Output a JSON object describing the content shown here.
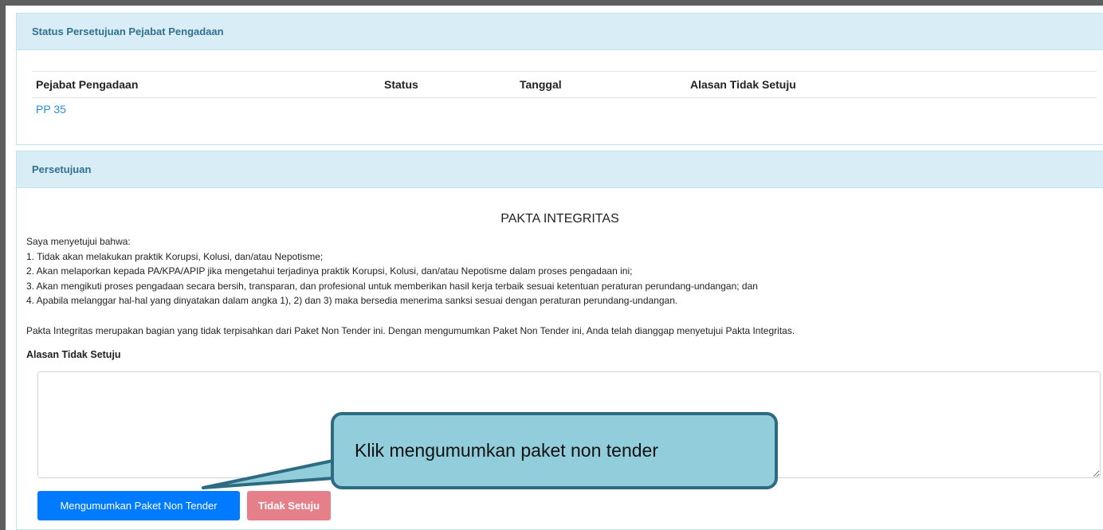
{
  "status_panel": {
    "heading": "Status Persetujuan Pejabat Pengadaan",
    "columns": [
      "Pejabat Pengadaan",
      "Status",
      "Tanggal",
      "Alasan Tidak Setuju"
    ],
    "rows": [
      {
        "pejabat": "PP 35",
        "status": "",
        "tanggal": "",
        "alasan": ""
      }
    ]
  },
  "approval_panel": {
    "heading": "Persetujuan",
    "pakta_title": "PAKTA INTEGRITAS",
    "intro": "Saya menyetujui bahwa:",
    "items": [
      "1. Tidak akan melakukan praktik Korupsi, Kolusi, dan/atau Nepotisme;",
      "2. Akan melaporkan kepada PA/KPA/APIP jika mengetahui terjadinya praktik Korupsi, Kolusi, dan/atau Nepotisme dalam proses pengadaan ini;",
      "3. Akan mengikuti proses pengadaan secara bersih, transparan, dan profesional untuk memberikan hasil kerja terbaik sesuai ketentuan peraturan perundang-undangan; dan",
      "4. Apabila melanggar hal-hal yang dinyatakan dalam angka 1), 2) dan 3) maka bersedia menerima sanksi sesuai dengan peraturan perundang-undangan."
    ],
    "closing": "Pakta Integritas merupakan bagian yang tidak terpisahkan dari Paket Non Tender ini. Dengan mengumumkan Paket Non Tender ini, Anda telah dianggap menyetujui Pakta Integritas.",
    "reason_label": "Alasan Tidak Setuju",
    "reason_value": "",
    "announce_button": "Mengumumkan Paket Non Tender",
    "reject_button": "Tidak Setuju"
  },
  "callout": {
    "text": "Klik mengumumkan paket non tender"
  },
  "colors": {
    "primary": "#007bff",
    "danger_disabled": "#e57f8a",
    "panel_heading_bg": "#d9edf7",
    "panel_heading_text": "#31708f",
    "callout_fill": "#92cddc",
    "callout_border": "#2c6b82"
  }
}
